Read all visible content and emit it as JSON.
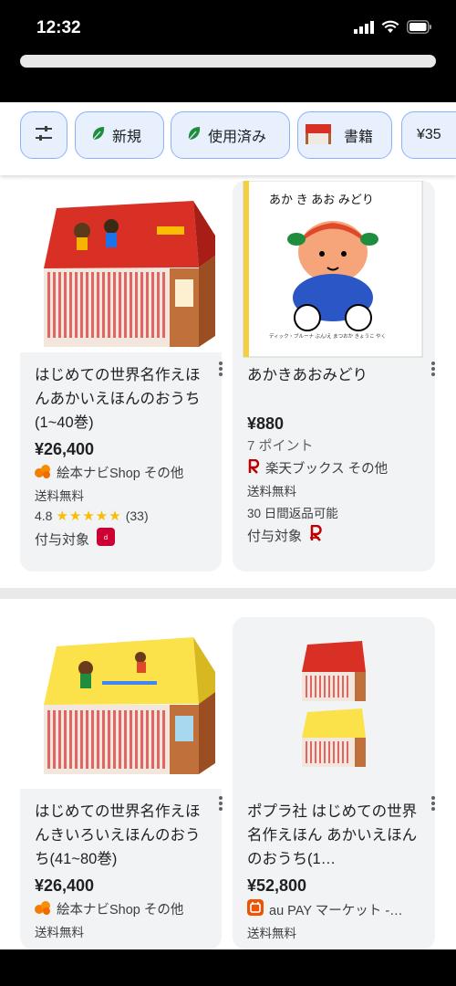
{
  "status": {
    "time": "12:32"
  },
  "filters": {
    "chips": [
      {
        "label": "新規",
        "icon": "leaf-icon"
      },
      {
        "label": "使用済み",
        "icon": "leaf-icon"
      },
      {
        "label": "書籍",
        "icon": "book-thumb-icon"
      },
      {
        "label": "¥35"
      }
    ]
  },
  "products": [
    {
      "title": "はじめての世界名作えほんあかいえほんのおうち(1~40巻)",
      "price": "¥26,400",
      "seller": "絵本ナビShop その他",
      "shipping": "送料無料",
      "rating": "4.8",
      "stars": "★★★★★",
      "reviews": "(33)",
      "reward": "付与対象"
    },
    {
      "title": "あかきあおみどり",
      "price": "¥880",
      "points": "7 ポイント",
      "seller": "楽天ブックス その他",
      "shipping": "送料無料",
      "returns": "30 日間返品可能",
      "reward": "付与対象",
      "cover_title": "あか き あお みどり",
      "cover_credit": "ディック・ブルーナ ぶん/え   まつおか きょうこ やく"
    },
    {
      "title": "はじめての世界名作えほんきいろいえほんのおうち(41~80巻)",
      "price": "¥26,400",
      "seller": "絵本ナビShop その他",
      "shipping": "送料無料"
    },
    {
      "title": "ポプラ社 はじめての世界名作えほん あかいえほんのおうち(1…",
      "price": "¥52,800",
      "seller": "au PAY マーケット -…",
      "shipping": "送料無料"
    }
  ],
  "colors": {
    "accent": "#1a73e8",
    "chip_bg": "#e8f0fe",
    "rakuten": "#bf0000",
    "star": "#fbbc04"
  }
}
